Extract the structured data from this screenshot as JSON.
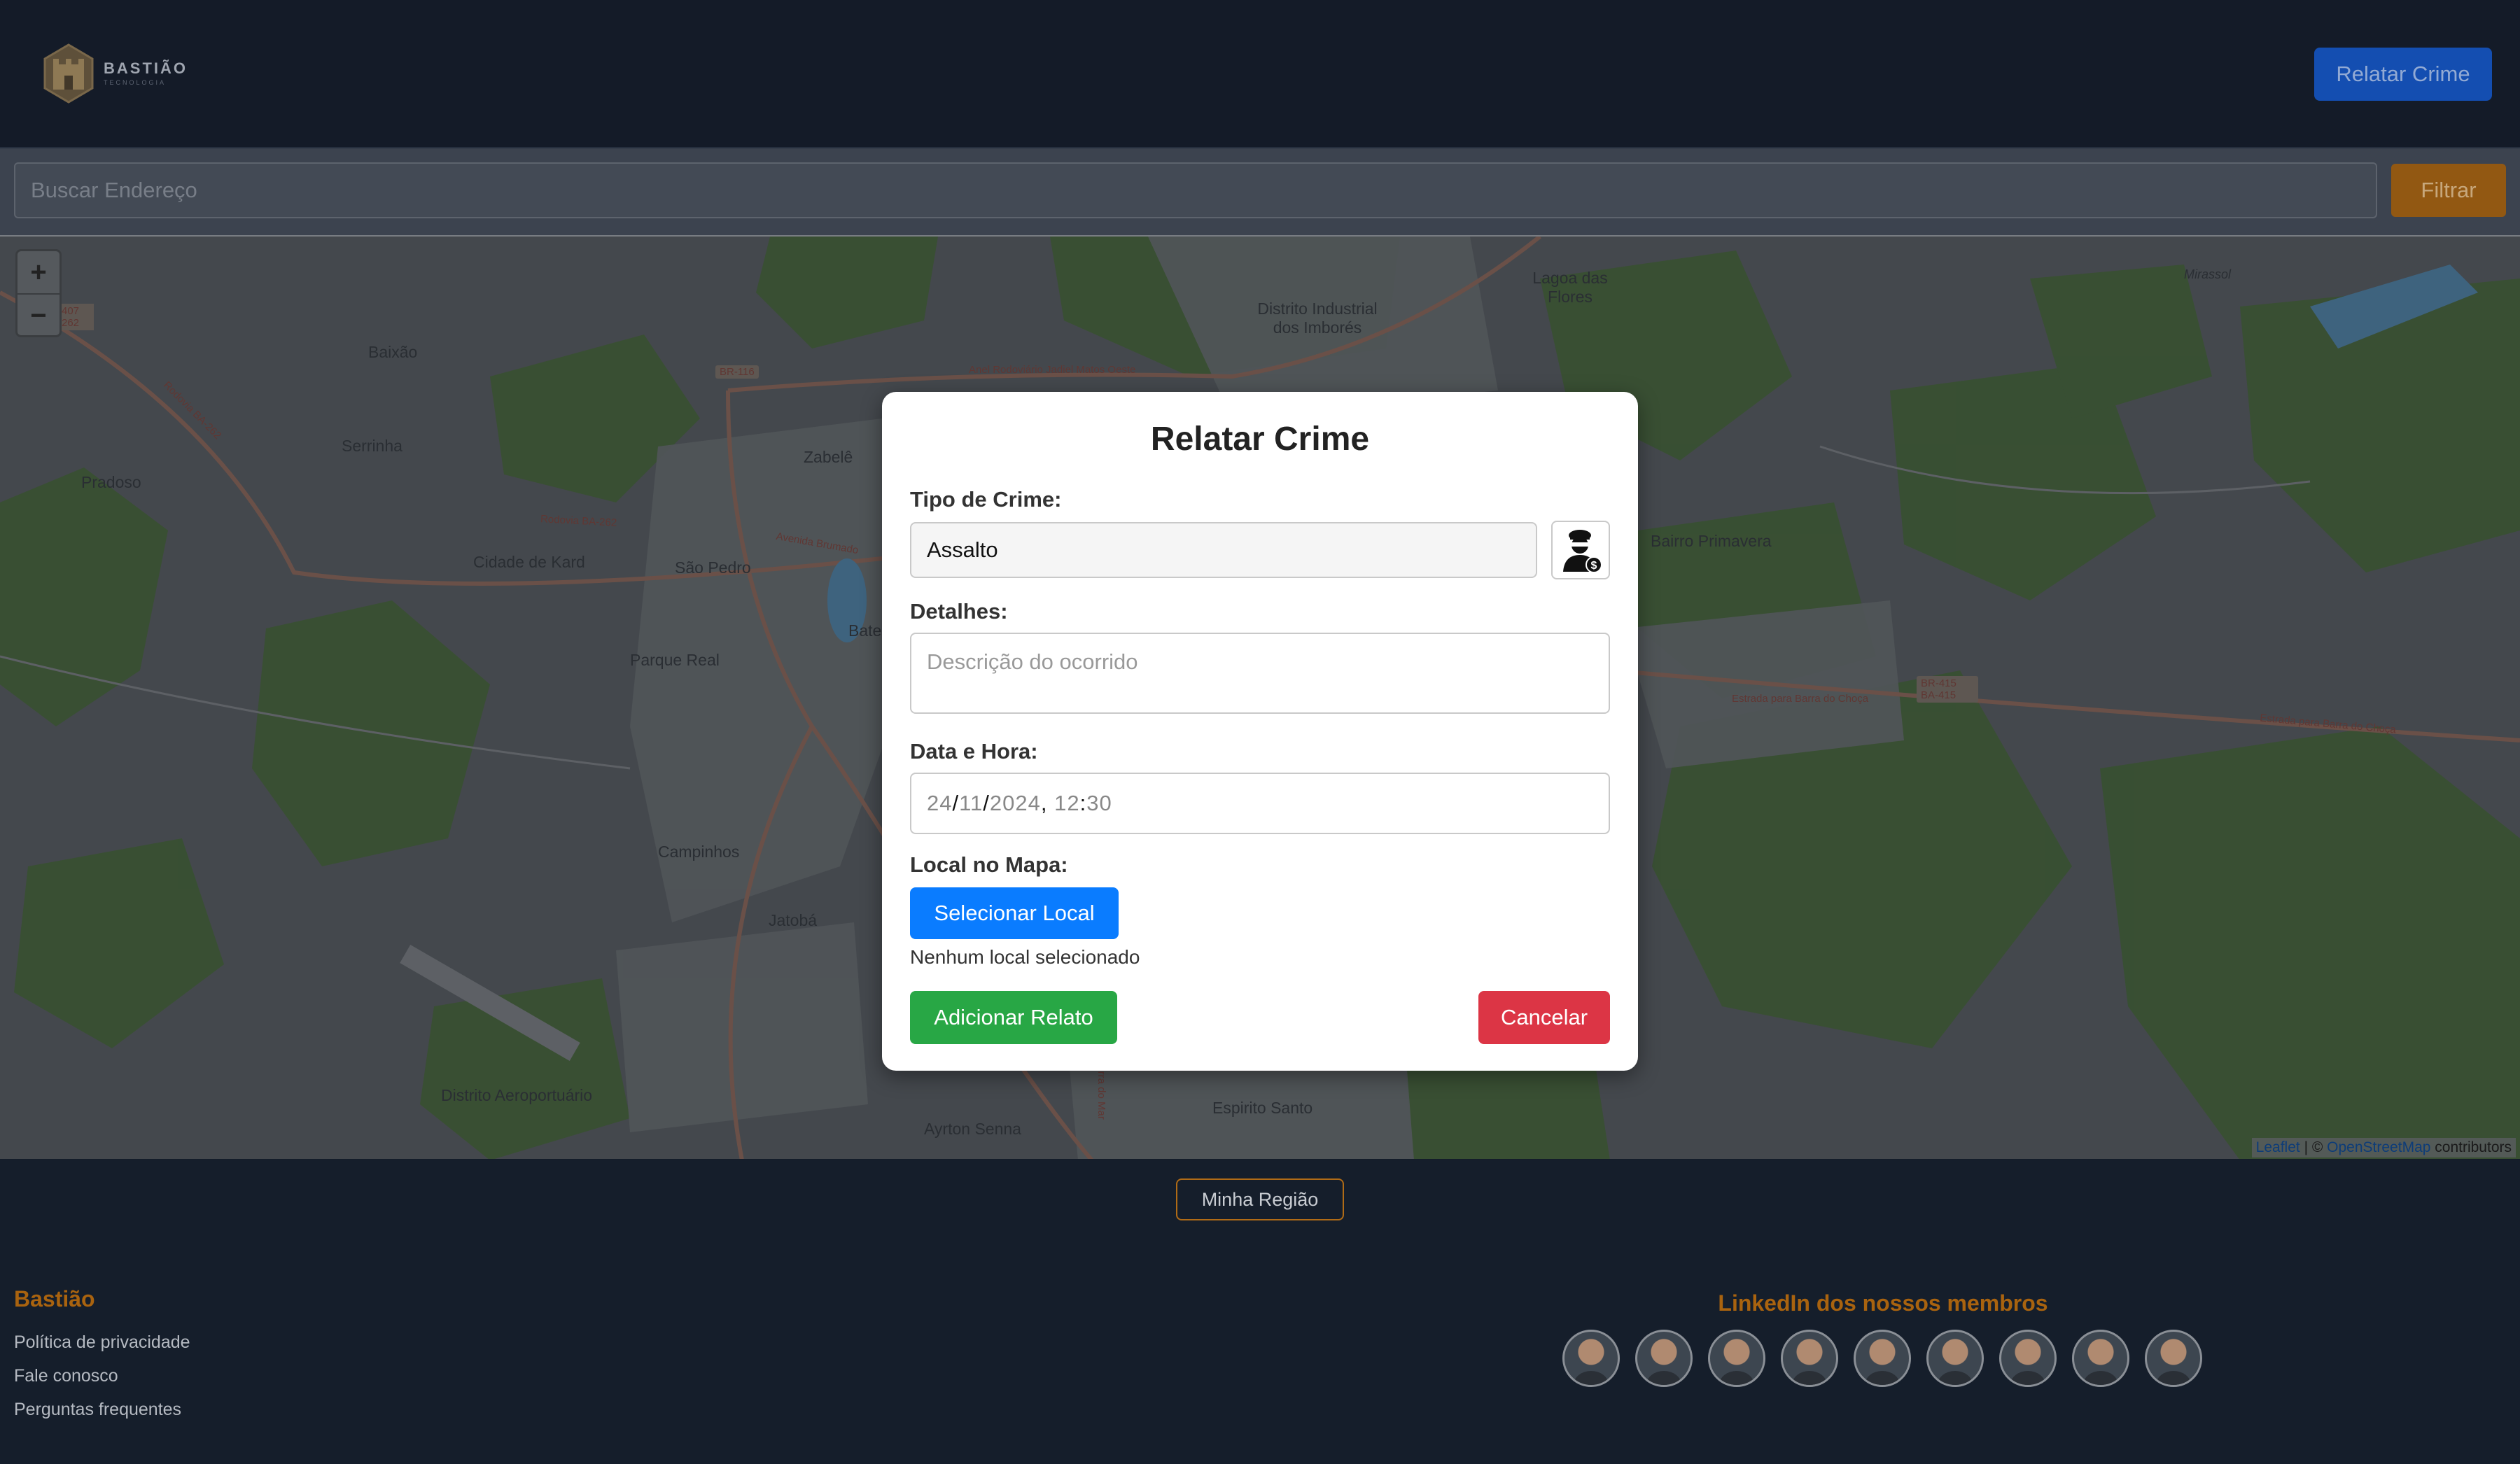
{
  "header": {
    "logo_text": "BASTIÃO",
    "logo_subtext": "TECNOLOGIA",
    "report_button": "Relatar Crime"
  },
  "search": {
    "placeholder": "Buscar Endereço",
    "filter_button": "Filtrar"
  },
  "map": {
    "zoom_in": "+",
    "zoom_out": "−",
    "places": [
      "Baixão",
      "Serrinha",
      "Pradoso",
      "Cidade de Kard",
      "São Pedro",
      "Zabelê",
      "Parque Real",
      "Campinhos",
      "Jatobá",
      "Distrito Aeroportuário",
      "Ayrton Senna",
      "Espirito Santo",
      "Distrito Industrial dos Imborés",
      "Lagoa das Flores",
      "Bairro Primavera",
      "Mirassol",
      "Bate"
    ],
    "roads": [
      "BR-116",
      "Rodovia BA-262",
      "Rodovia BA-262",
      "Anel Rodoviário Jadiel Matos Oeste",
      "Avenida Brumado",
      "Estrada para Barra do Choça",
      "Estrada para Barra do Choça",
      "BR-415 BA-415",
      "Rodovia Serra do Mar",
      "407 262"
    ],
    "attribution_leaflet": "Leaflet",
    "attribution_sep": " | © ",
    "attribution_osm": "OpenStreetMap",
    "attribution_suffix": " contributors"
  },
  "modal": {
    "title": "Relatar Crime",
    "crime_type_label": "Tipo de Crime:",
    "crime_type_value": "Assalto",
    "crime_icon": "robber-icon",
    "details_label": "Detalhes:",
    "details_placeholder": "Descrição do ocorrido",
    "datetime_label": "Data e Hora:",
    "datetime": {
      "day": "24",
      "month": "11",
      "year": "2024",
      "hour": "12",
      "minute": "30"
    },
    "location_label": "Local no Mapa:",
    "select_location_button": "Selecionar Local",
    "no_location_text": "Nenhum local selecionado",
    "add_button": "Adicionar Relato",
    "cancel_button": "Cancelar"
  },
  "footer": {
    "region_button": "Minha Região",
    "brand": "Bastião",
    "links": [
      "Política de privacidade",
      "Fale conosco",
      "Perguntas frequentes"
    ],
    "members_title": "LinkedIn dos nossos membros",
    "member_count": 9
  },
  "colors": {
    "accent_orange": "#a9630f",
    "primary_blue": "#0a7cff",
    "success_green": "#28a745",
    "danger_red": "#dc3545",
    "header_bg": "#141c28"
  }
}
